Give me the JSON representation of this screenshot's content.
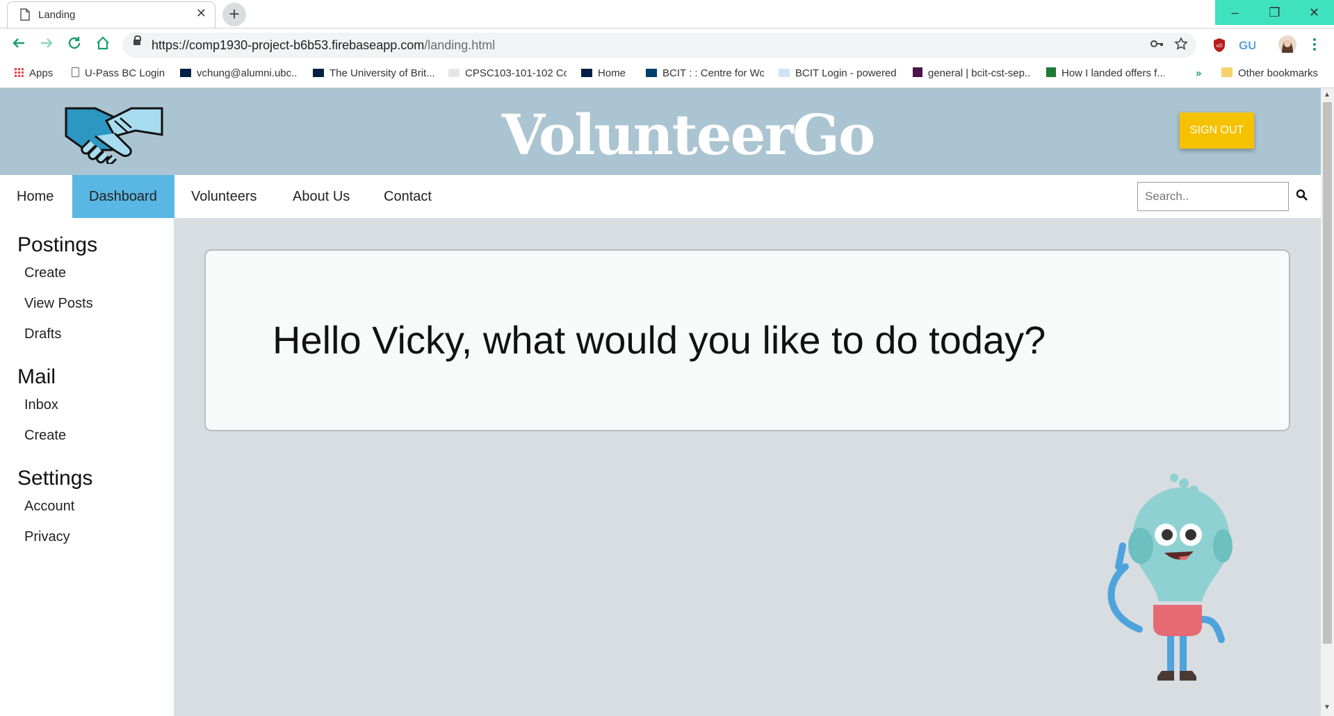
{
  "browser": {
    "tab_title": "Landing",
    "new_tab_symbol": "+",
    "url_host": "https://comp1930-project-b6b53.firebaseapp.com",
    "url_path": "/landing.html",
    "bookmarks": [
      "Apps",
      "U-Pass BC Login",
      "vchung@alumni.ubc...",
      "The University of Brit...",
      "CPSC103-101-102 Co...",
      "Home",
      "BCIT : : Centre for Wo...",
      "BCIT Login - powered...",
      "general | bcit-cst-sep...",
      "How I landed offers f..."
    ],
    "overflow_chevron": "»",
    "other_bookmarks": "Other bookmarks",
    "window_controls": [
      "–",
      "❐",
      "✕"
    ]
  },
  "site": {
    "brand": "VolunteerGo",
    "sign_out": "SIGN OUT",
    "nav": [
      "Home",
      "Dashboard",
      "Volunteers",
      "About Us",
      "Contact"
    ],
    "active_nav": "Dashboard",
    "search_placeholder": "Search.."
  },
  "sidebar": {
    "sections": [
      {
        "title": "Postings",
        "items": [
          "Create",
          "View Posts",
          "Drafts"
        ]
      },
      {
        "title": "Mail",
        "items": [
          "Inbox",
          "Create"
        ]
      },
      {
        "title": "Settings",
        "items": [
          "Account",
          "Privacy"
        ]
      }
    ]
  },
  "main": {
    "greeting": "Hello Vicky, what would you like to do today?"
  },
  "colors": {
    "header_bg": "#abc4d1",
    "active_nav": "#5ab6e3",
    "signout": "#f6c200",
    "main_bg": "#d7dde1",
    "window_controls": "#3fe1bf"
  }
}
